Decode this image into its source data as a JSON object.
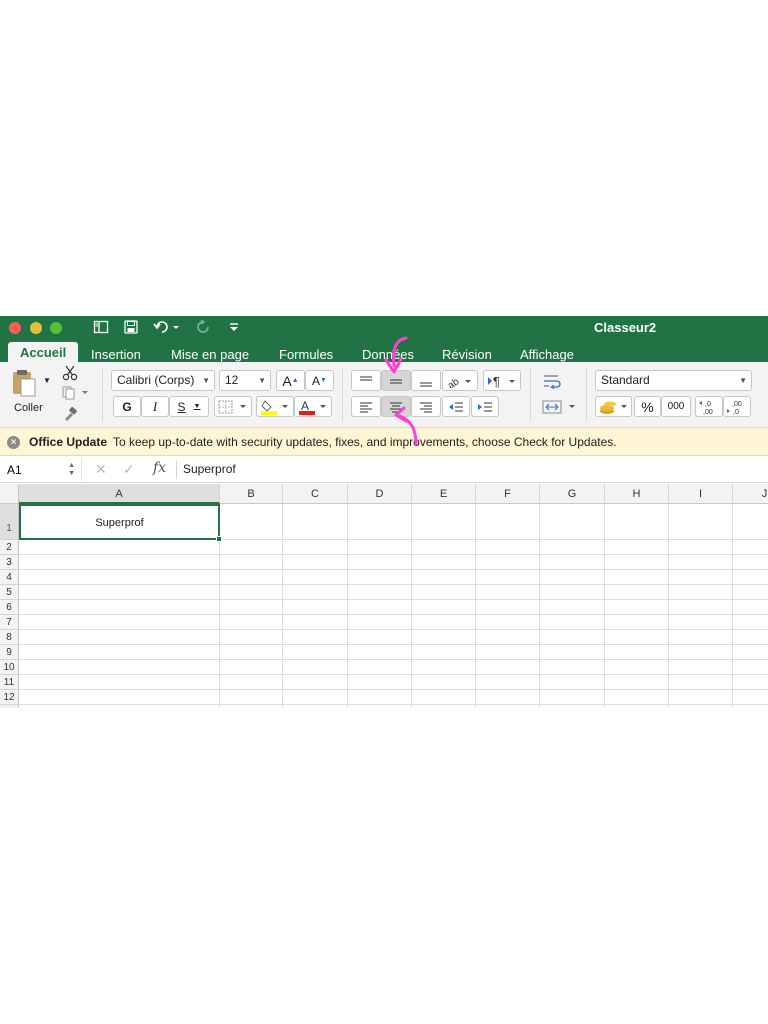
{
  "window": {
    "title": "Classeur2"
  },
  "tabs": [
    {
      "label": "Accueil",
      "active": true
    },
    {
      "label": "Insertion"
    },
    {
      "label": "Mise en page"
    },
    {
      "label": "Formules"
    },
    {
      "label": "Données"
    },
    {
      "label": "Révision"
    },
    {
      "label": "Affichage"
    }
  ],
  "ribbon": {
    "paste_label": "Coller",
    "font_name": "Calibri (Corps)",
    "font_size": "12",
    "grow_font": "A",
    "shrink_font": "A",
    "bold": "G",
    "italic": "I",
    "underline": "S",
    "number_format": "Standard",
    "percent": "%",
    "thousands": "000",
    "increase_decimal": ",0\n,00",
    "decrease_decimal": ",00\n,0",
    "font_color": "#e02020",
    "highlight_color": "#ffff00",
    "accent": "#217346"
  },
  "update_bar": {
    "label": "Office Update",
    "message": "To keep up-to-date with security updates, fixes, and improvements, choose Check for Updates."
  },
  "formula_bar": {
    "name_box": "A1",
    "fx": "fx",
    "value": "Superprof"
  },
  "sheet": {
    "columns": [
      "A",
      "B",
      "C",
      "D",
      "E",
      "F",
      "G",
      "H",
      "I",
      "J"
    ],
    "rows": [
      "1",
      "2",
      "3",
      "4",
      "5",
      "6",
      "7",
      "8",
      "9",
      "10",
      "11",
      "12"
    ],
    "cells": {
      "A1": "Superprof"
    },
    "active_cell": "A1"
  },
  "annotations": {
    "arrow_color": "#ff3fd2"
  }
}
